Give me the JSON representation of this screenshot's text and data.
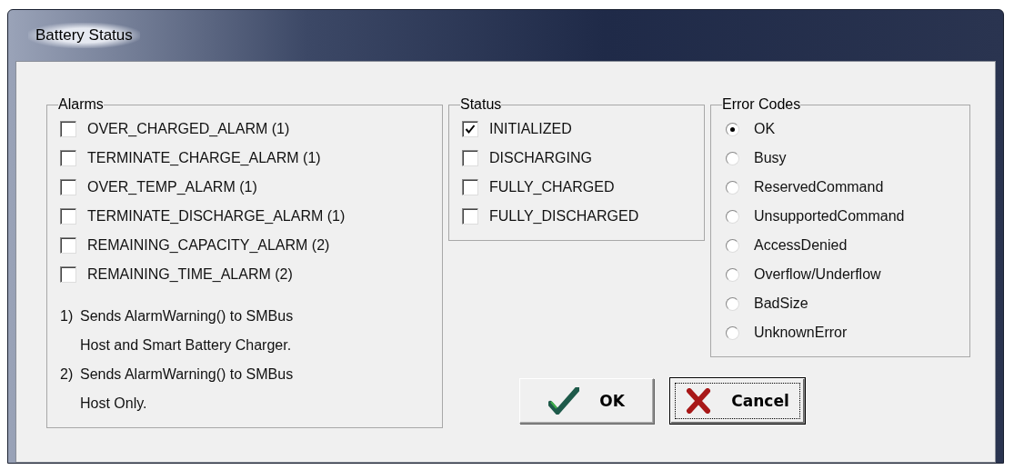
{
  "window": {
    "title": "Battery Status"
  },
  "alarms": {
    "title": "Alarms",
    "items": [
      {
        "label": "OVER_CHARGED_ALARM (1)",
        "checked": false
      },
      {
        "label": "TERMINATE_CHARGE_ALARM (1)",
        "checked": false
      },
      {
        "label": "OVER_TEMP_ALARM (1)",
        "checked": false
      },
      {
        "label": "TERMINATE_DISCHARGE_ALARM (1)",
        "checked": false
      },
      {
        "label": "REMAINING_CAPACITY_ALARM (2)",
        "checked": false
      },
      {
        "label": "REMAINING_TIME_ALARM (2)",
        "checked": false
      }
    ],
    "notes": [
      {
        "marker": "1)",
        "text": "Sends AlarmWarning() to SMBus Host and Smart Battery Charger."
      },
      {
        "marker": "2)",
        "text": "Sends AlarmWarning() to SMBus Host Only."
      }
    ]
  },
  "status": {
    "title": "Status",
    "items": [
      {
        "label": "INITIALIZED",
        "checked": true
      },
      {
        "label": "DISCHARGING",
        "checked": false
      },
      {
        "label": "FULLY_CHARGED",
        "checked": false
      },
      {
        "label": "FULLY_DISCHARGED",
        "checked": false
      }
    ]
  },
  "error_codes": {
    "title": "Error Codes",
    "items": [
      {
        "label": "OK",
        "selected": true
      },
      {
        "label": "Busy",
        "selected": false
      },
      {
        "label": "ReservedCommand",
        "selected": false
      },
      {
        "label": "UnsupportedCommand",
        "selected": false
      },
      {
        "label": "AccessDenied",
        "selected": false
      },
      {
        "label": "Overflow/Underflow",
        "selected": false
      },
      {
        "label": "BadSize",
        "selected": false
      },
      {
        "label": "UnknownError",
        "selected": false
      }
    ]
  },
  "buttons": [
    {
      "kind": "ok",
      "label": "OK",
      "focused": false
    },
    {
      "kind": "cancel",
      "label": "Cancel",
      "focused": true
    }
  ]
}
